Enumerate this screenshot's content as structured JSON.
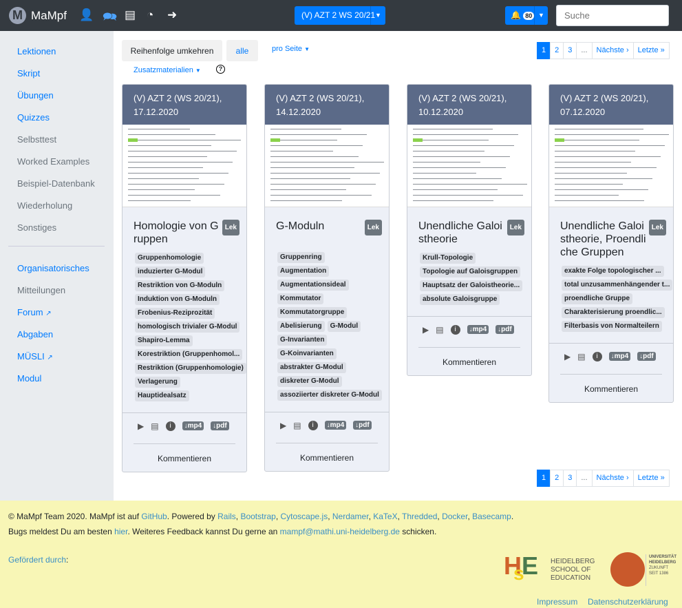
{
  "nav": {
    "brand": "MaMpf",
    "logo_letter": "M",
    "course": "(V) AZT 2 WS 20/21",
    "notif_count": "80",
    "search_placeholder": "Suche"
  },
  "sidebar": {
    "items": [
      "Lektionen",
      "Skript",
      "Übungen",
      "Quizzes",
      "Selbsttest",
      "Worked Examples",
      "Beispiel-Datenbank",
      "Wiederholung",
      "Sonstiges"
    ],
    "items2": [
      "Organisatorisches",
      "Mitteilungen",
      "Forum",
      "Abgaben",
      "MÜSLI",
      "Modul"
    ]
  },
  "toolbar": {
    "reverse": "Reihenfolge umkehren",
    "all": "alle",
    "per_page": "pro Seite",
    "extra": "Zusatzmaterialien"
  },
  "pagination": [
    "1",
    "2",
    "3",
    "...",
    "Nächste ›",
    "Letzte »"
  ],
  "cards": [
    {
      "header": "(V) AZT 2 (WS 20/21), 17.12.2020",
      "title": "Homologie von Gruppen",
      "badge": "Lek",
      "tags": [
        "Gruppenhomologie",
        "induzierter G-Modul",
        "Restriktion von G-Moduln",
        "Induktion von G-Moduln",
        "Frobenius-Reziprozität",
        "homologisch trivialer G-Modul",
        "Shapiro-Lemma",
        "Korestriktion (Gruppenhomol...",
        "Restriktion (Gruppenhomologie)",
        "Verlagerung",
        "Hauptidealsatz"
      ],
      "comment": "Kommentieren"
    },
    {
      "header": "(V) AZT 2 (WS 20/21), 14.12.2020",
      "title": "G-Moduln",
      "badge": "Lek",
      "tags": [
        "Gruppenring",
        "Augmentation",
        "Augmentationsideal",
        "Kommutator",
        "Kommutatorgruppe",
        "Abelisierung",
        "G-Modul",
        "G-Invarianten",
        "G-Koinvarianten",
        "abstrakter G-Modul",
        "diskreter G-Modul",
        "assoziierter diskreter G-Modul"
      ],
      "comment": "Kommentieren"
    },
    {
      "header": "(V) AZT 2 (WS 20/21), 10.12.2020",
      "title": "Unendliche Galoistheorie",
      "badge": "Lek",
      "tags": [
        "Krull-Topologie",
        "Topologie auf Galoisgruppen",
        "Hauptsatz der Galoistheorie...",
        "absolute Galoisgruppe"
      ],
      "comment": "Kommentieren"
    },
    {
      "header": "(V) AZT 2 (WS 20/21), 07.12.2020",
      "title": "Unendliche Galoistheorie, Proendliche Gruppen",
      "badge": "Lek",
      "tags": [
        "exakte Folge topologischer ...",
        "total unzusammenhängender t...",
        "proendliche Gruppe",
        "Charakterisierung proendlic...",
        "Filterbasis von Normalteilern"
      ],
      "comment": "Kommentieren"
    }
  ],
  "actions": {
    "mp4": "↓mp4",
    "pdf": "↓pdf"
  },
  "footer": {
    "line1_pre": "© MaMpf Team 2020. MaMpf ist auf ",
    "github": "GitHub",
    "line1_mid": ". Powered by ",
    "powered": [
      "Rails",
      "Bootstrap",
      "Cytoscape.js",
      "Nerdamer",
      "KaTeX",
      "Thredded",
      "Docker",
      "Basecamp"
    ],
    "line2_pre": "Bugs meldest Du am besten ",
    "hier": "hier",
    "line2_mid": ". Weiteres Feedback kannst Du gerne an ",
    "email": "mampf@mathi.uni-heidelberg.de",
    "line2_post": " schicken.",
    "funded": "Gefördert durch",
    "hse": [
      "HEIDELBERG",
      "SCHOOL OF",
      "EDUCATION"
    ],
    "uni": [
      "UNIVERSITÄT",
      "HEIDELBERG",
      "ZUKUNFT",
      "SEIT 1386"
    ],
    "impressum": "Impressum",
    "privacy": "Datenschutzerklärung"
  }
}
